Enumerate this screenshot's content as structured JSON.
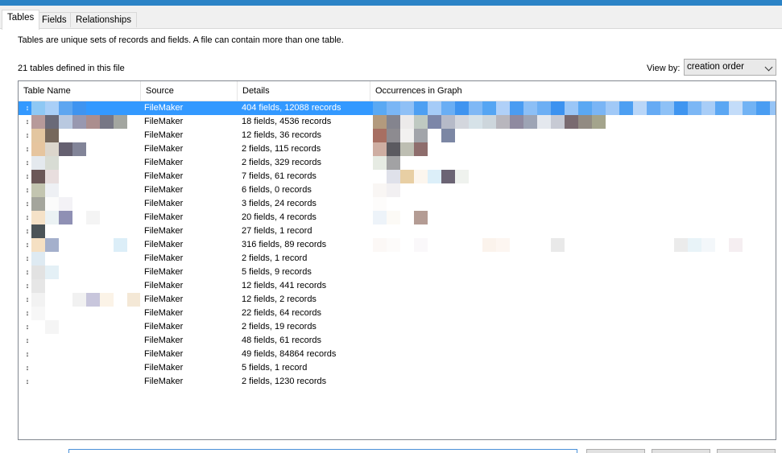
{
  "tabs": [
    {
      "label": "Tables",
      "active": true
    },
    {
      "label": "Fields",
      "active": false
    },
    {
      "label": "Relationships",
      "active": false
    }
  ],
  "description": "Tables are unique sets of records and fields. A file can contain more than one table.",
  "table_count": "21 tables defined in this file",
  "view_by": {
    "label": "View by:",
    "value": "creation order"
  },
  "columns": [
    "Table Name",
    "Source",
    "Details",
    "Occurrences in Graph"
  ],
  "selection_color": "#3399ff",
  "rows": [
    {
      "source": "FileMaker",
      "details": "404 fields, 12088 records",
      "selected": true,
      "name_swatches": [
        "#8ec8f4",
        "#a9cff7",
        "#5ea6f0",
        "#3f94f0"
      ],
      "occ_swatches": [
        "#5aa9f3",
        "#7ab6f5",
        "#8fc0f6",
        "#4d9ff2",
        "#a5cbf7",
        "#6aaef4",
        "#3f94f0",
        "#7fb8f5",
        "#55a5f3",
        "#b0d0f8",
        "#4a9cf2",
        "#8cbff6",
        "#6daff4",
        "#3c92f0",
        "#9ac6f7",
        "#5aa8f3",
        "#7ab5f5",
        "#a1c9f7",
        "#4d9ff2",
        "#b9d6f8",
        "#66abf4",
        "#8ec1f6",
        "#3f95f0",
        "#7cb7f5",
        "#a8cdf7",
        "#5ba7f3",
        "#c3dcf9",
        "#72b3f4",
        "#4a9df2",
        "#96c4f6"
      ]
    },
    {
      "source": "FileMaker",
      "details": "18 fields, 4536 records",
      "selected": false,
      "name_swatches": [
        "#b79a9a",
        "#6a6a78",
        "#b9c9e0",
        "#9898b0",
        "#ab8e8e",
        "#777785",
        "#a3a6a0"
      ],
      "occ_swatches": [
        "#b39a7d",
        "#84848e",
        "#eceaea",
        "#bfc9c1",
        "#7c86a8",
        "#b6bac8",
        "#d3d6dd",
        "#d6e2e8",
        "#cdd6dc",
        "#b8b6bd",
        "#8f8aa0",
        "#9da4b5",
        "#e4e8ee",
        "#c7cad4",
        "#796a70",
        "#928b82",
        "#a4a48c"
      ]
    },
    {
      "source": "FileMaker",
      "details": "12 fields, 36 records",
      "selected": false,
      "name_swatches": [
        "#e3c6a0",
        "#76685c"
      ],
      "occ_swatches": [
        "#a76f62",
        "#8d8b90",
        "#f2f1f0",
        "#a2a5aa",
        "#ffffff",
        "#7c87a4"
      ]
    },
    {
      "source": "FileMaker",
      "details": "2 fields, 115 records",
      "selected": false,
      "name_swatches": [
        "#e6c59f",
        "#dcd6cc",
        "#656070",
        "#828498"
      ],
      "occ_swatches": [
        "#ceaea2",
        "#5b5a60",
        "#bdbeb2",
        "#8e6d6c"
      ]
    },
    {
      "source": "FileMaker",
      "details": "2 fields, 329 records",
      "selected": false,
      "name_swatches": [
        "#e4e9ee",
        "#d8dcd4"
      ],
      "occ_swatches": [
        "#e6ebe3",
        "#a2a2a4"
      ]
    },
    {
      "source": "FileMaker",
      "details": "7 fields, 61 records",
      "selected": false,
      "name_swatches": [
        "#6c5858",
        "#e8dede"
      ],
      "occ_swatches": [
        "#ffffff",
        "#dfe1ea",
        "#e8cfa4",
        "#fcf6ee",
        "#dceff9",
        "#6b6474",
        "#eff2ee"
      ]
    },
    {
      "source": "FileMaker",
      "details": "6 fields, 0 records",
      "selected": false,
      "name_swatches": [
        "#c3c5b0",
        "#eef0f4"
      ],
      "occ_swatches": [
        "#f9f6f4",
        "#f2f0f2"
      ]
    },
    {
      "source": "FileMaker",
      "details": "3 fields, 24 records",
      "selected": false,
      "name_swatches": [
        "#a4a59c",
        "#fbfbfb",
        "#f3f2f6"
      ],
      "occ_swatches": [
        "#fdfcfb"
      ]
    },
    {
      "source": "FileMaker",
      "details": "20 fields, 4 records",
      "selected": false,
      "name_swatches": [
        "#f5e2c8",
        "#ebf2f4",
        "#8f90b4",
        "#ffffff",
        "#f4f4f4"
      ],
      "occ_swatches": [
        "#edf3f9",
        "#fcfaf6",
        "#ffffff",
        "#b49c94"
      ]
    },
    {
      "source": "FileMaker",
      "details": "27 fields, 1 record",
      "selected": false,
      "name_swatches": [
        "#4c5458"
      ],
      "occ_swatches": []
    },
    {
      "source": "FileMaker",
      "details": "316 fields, 89 records",
      "selected": false,
      "name_swatches": [
        "#f5e0c3",
        "#a4b0cc",
        "#ffffff",
        "#ffffff",
        "#ffffff",
        "#ffffff",
        "#dceef8"
      ],
      "occ_swatches": [
        "#fcf8f6",
        "#fdfbfa",
        "#ffffff",
        "#faf8fa",
        "#ffffff",
        "#ffffff",
        "#ffffff",
        "#ffffff",
        "#fbf3ec",
        "#fdf6f1",
        "#ffffff",
        "#ffffff",
        "#ffffff",
        "#e9e9e9",
        "#ffffff",
        "#ffffff",
        "#ffffff",
        "#ffffff",
        "#ffffff",
        "#ffffff",
        "#ffffff",
        "#ffffff",
        "#ebebeb",
        "#e8f3f8",
        "#f3f7fa",
        "#ffffff",
        "#f5eef1"
      ]
    },
    {
      "source": "FileMaker",
      "details": "2 fields, 1 record",
      "selected": false,
      "name_swatches": [
        "#deeaf2"
      ],
      "occ_swatches": []
    },
    {
      "source": "FileMaker",
      "details": "5 fields, 9 records",
      "selected": false,
      "name_swatches": [
        "#e2e2e2",
        "#e4f0f6"
      ],
      "occ_swatches": []
    },
    {
      "source": "FileMaker",
      "details": "12 fields, 441 records",
      "selected": false,
      "name_swatches": [
        "#e6e6e6"
      ],
      "occ_swatches": []
    },
    {
      "source": "FileMaker",
      "details": "12 fields, 2 records",
      "selected": false,
      "name_swatches": [
        "#f2f2f2",
        "#ffffff",
        "#ffffff",
        "#f1f1f1",
        "#c8c6dc",
        "#fbf3e7",
        "#ffffff",
        "#f4e8d6"
      ],
      "occ_swatches": []
    },
    {
      "source": "FileMaker",
      "details": "22 fields, 64 records",
      "selected": false,
      "name_swatches": [
        "#f7f7f7"
      ],
      "occ_swatches": []
    },
    {
      "source": "FileMaker",
      "details": "2 fields, 19 records",
      "selected": false,
      "name_swatches": [
        "#ffffff",
        "#f5f5f5"
      ],
      "occ_swatches": []
    },
    {
      "source": "FileMaker",
      "details": "48 fields, 61 records",
      "selected": false,
      "name_swatches": [],
      "occ_swatches": []
    },
    {
      "source": "FileMaker",
      "details": "49 fields, 84864 records",
      "selected": false,
      "name_swatches": [],
      "occ_swatches": []
    },
    {
      "source": "FileMaker",
      "details": "5 fields, 1 record",
      "selected": false,
      "name_swatches": [],
      "occ_swatches": []
    },
    {
      "source": "FileMaker",
      "details": "2 fields, 1230 records",
      "selected": false,
      "name_swatches": [],
      "occ_swatches": []
    }
  ]
}
